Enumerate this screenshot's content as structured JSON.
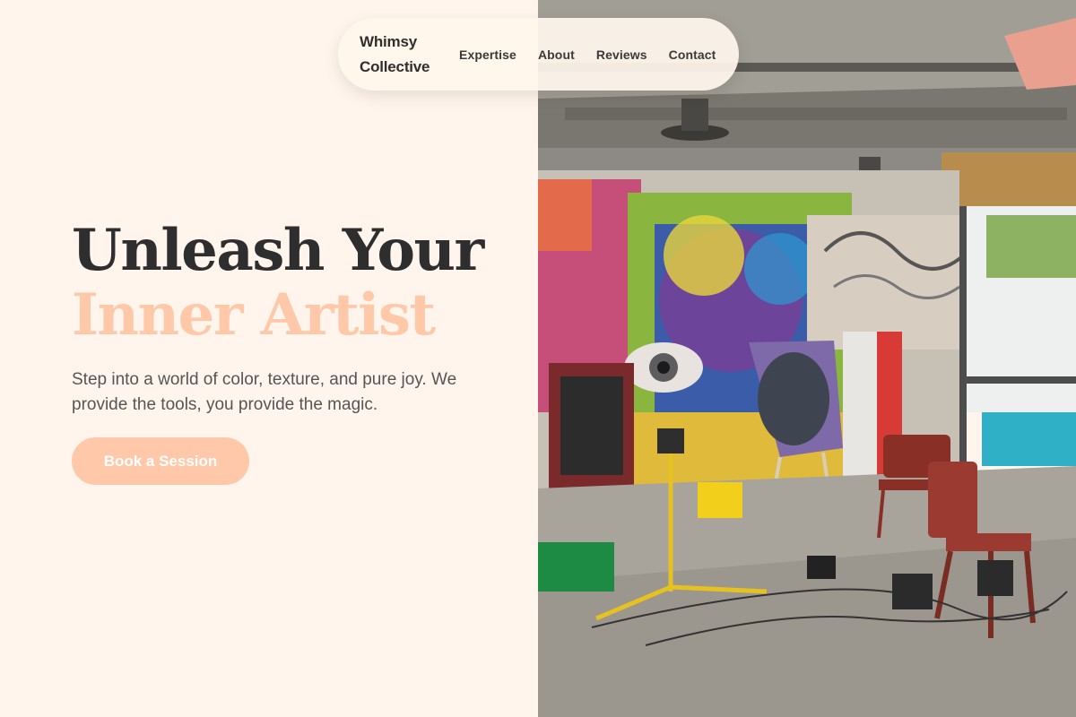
{
  "nav": {
    "brand_line1": "Whimsy",
    "brand_line2": "Collective",
    "links": [
      "Expertise",
      "About",
      "Reviews",
      "Contact"
    ]
  },
  "hero": {
    "title_line1": "Unleash Your",
    "title_line2": "Inner Artist",
    "description": "Step into a world of color, texture, and pure joy. We provide the tools, you provide the magic.",
    "cta_label": "Book a Session"
  },
  "colors": {
    "background": "#fff5ec",
    "accent": "#ffc8a8",
    "text": "#2e2e2e"
  }
}
